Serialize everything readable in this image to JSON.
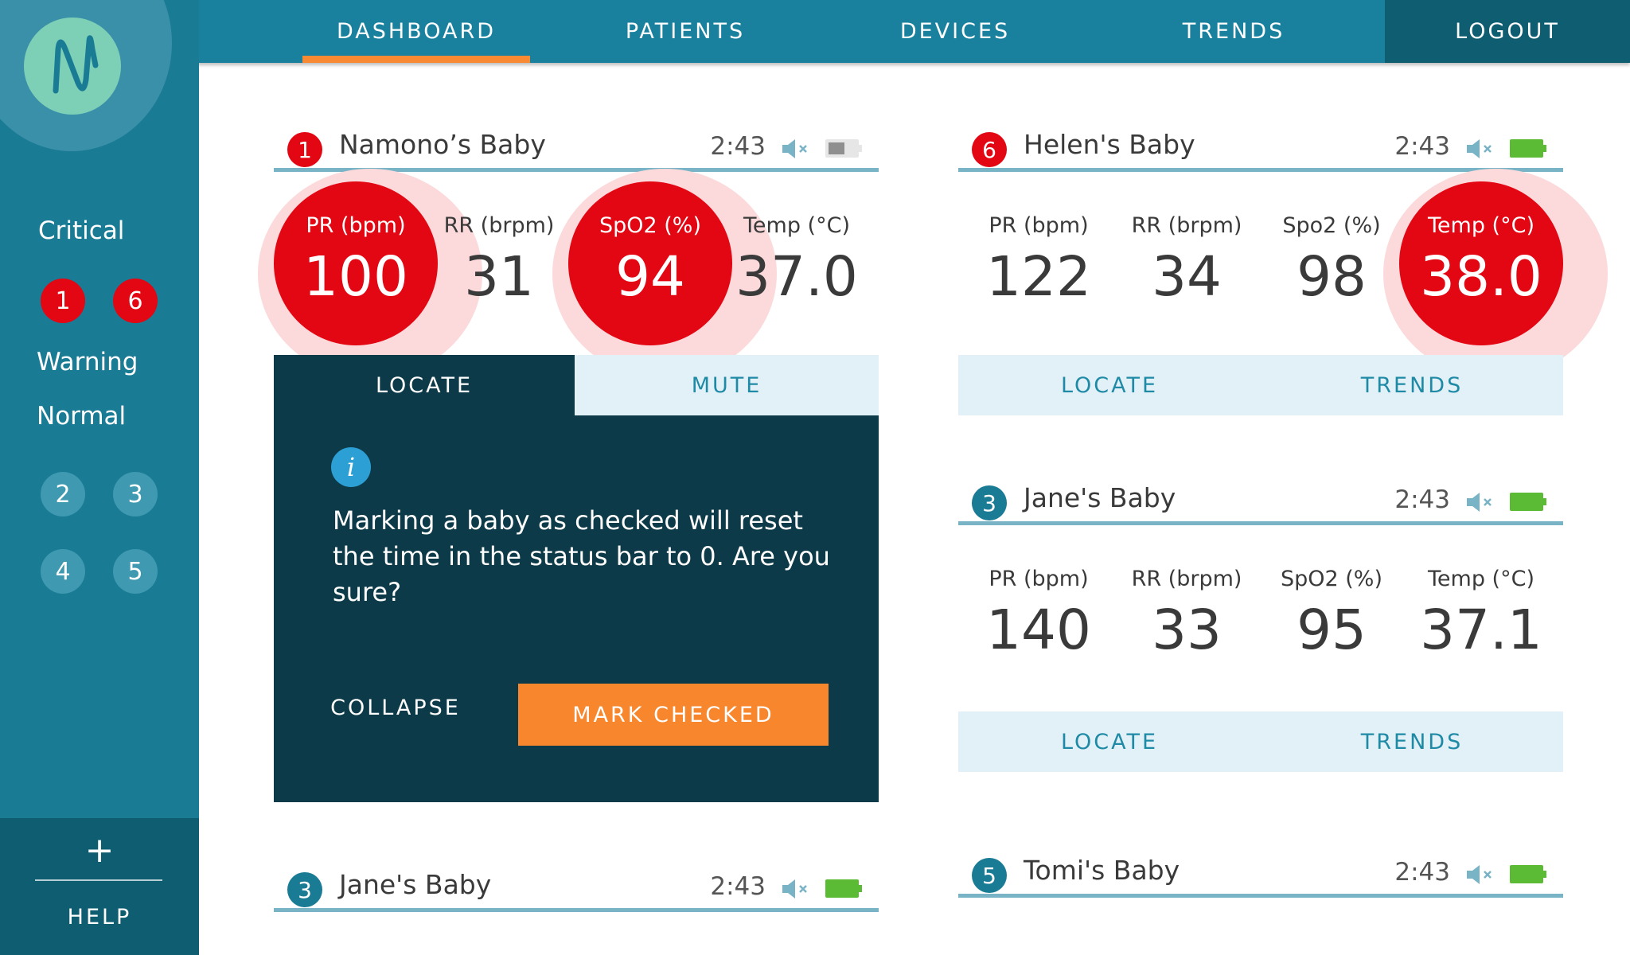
{
  "colors": {
    "primary": "#19809e",
    "sidebar": "#1a7b95",
    "dark": "#0d3a48",
    "critical": "#e30613",
    "accent": "#f7862c",
    "battery_ok": "#5cbb35"
  },
  "nav": {
    "dashboard": "DASHBOARD",
    "patients": "PATIENTS",
    "devices": "DEVICES",
    "trends": "TRENDS",
    "logout": "LOGOUT",
    "active": "dashboard"
  },
  "sidebar": {
    "logo_icon": "n-wave-logo-icon",
    "critical_label": "Critical",
    "critical": [
      "1",
      "6"
    ],
    "warning_label": "Warning",
    "normal_label": "Normal",
    "normal": [
      "2",
      "3",
      "4",
      "5"
    ],
    "plus": "+",
    "help": "HELP"
  },
  "cards": {
    "namono": {
      "number": "1",
      "name": "Namono’s Baby",
      "time": "2:43",
      "battery": "low",
      "vitals": [
        {
          "label": "PR (bpm)",
          "value": "100",
          "alarm": true
        },
        {
          "label": "RR (brpm)",
          "value": "31",
          "alarm": false
        },
        {
          "label": "SpO2 (%)",
          "value": "94",
          "alarm": true
        },
        {
          "label": "Temp (°C)",
          "value": "37.0",
          "alarm": false
        }
      ],
      "locate": "LOCATE",
      "mute": "MUTE",
      "info_icon": "i",
      "message": "Marking a baby as checked will reset the time in the status bar to 0. Are you sure?",
      "collapse": "COLLAPSE",
      "mark_checked": "MARK CHECKED"
    },
    "helen": {
      "number": "6",
      "name": "Helen's Baby",
      "time": "2:43",
      "battery": "full",
      "vitals": [
        {
          "label": "PR (bpm)",
          "value": "122",
          "alarm": false
        },
        {
          "label": "RR (brpm)",
          "value": "34",
          "alarm": false
        },
        {
          "label": "Spo2 (%)",
          "value": "98",
          "alarm": false
        },
        {
          "label": "Temp (°C)",
          "value": "38.0",
          "alarm": true
        }
      ],
      "locate": "LOCATE",
      "trends": "TRENDS"
    },
    "jane_right": {
      "number": "3",
      "name": "Jane's Baby",
      "time": "2:43",
      "battery": "full",
      "vitals": [
        {
          "label": "PR (bpm)",
          "value": "140",
          "alarm": false
        },
        {
          "label": "RR (brpm)",
          "value": "33",
          "alarm": false
        },
        {
          "label": "SpO2 (%)",
          "value": "95",
          "alarm": false
        },
        {
          "label": "Temp (°C)",
          "value": "37.1",
          "alarm": false
        }
      ],
      "locate": "LOCATE",
      "trends": "TRENDS"
    },
    "jane_left": {
      "number": "3",
      "name": "Jane's Baby",
      "time": "2:43",
      "battery": "full"
    },
    "tomi": {
      "number": "5",
      "name": "Tomi's Baby",
      "time": "2:43",
      "battery": "full"
    }
  }
}
